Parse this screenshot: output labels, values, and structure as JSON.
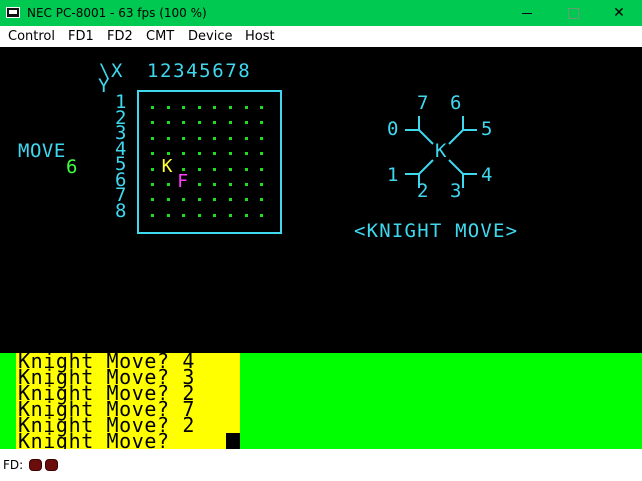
{
  "window": {
    "title": "NEC PC-8001 - 63 fps (100 %)",
    "minimize": "minimize",
    "maximize": "maximize",
    "close": "close"
  },
  "menu": [
    "Control",
    "FD1",
    "FD2",
    "CMT",
    "Device",
    "Host"
  ],
  "game": {
    "axis_corner": "\\X",
    "axis_y": "Y",
    "x_labels": "12345678",
    "y_labels": [
      "1",
      "2",
      "3",
      "4",
      "5",
      "6",
      "7",
      "8"
    ],
    "move_label": "MOVE",
    "move_value": "6",
    "knight_glyph": "K",
    "finish_glyph": "F",
    "knight_pos": {
      "x": 2,
      "y": 5
    },
    "finish_pos": {
      "x": 3,
      "y": 6
    },
    "direction_labels": [
      "0",
      "1",
      "2",
      "3",
      "4",
      "5",
      "6",
      "7"
    ],
    "diagram_center": "K",
    "diagram_caption": "<KNIGHT MOVE>",
    "colors": {
      "cyan": "#3fd8ee",
      "dot_green": "#19e019",
      "knight": "#ffff3c",
      "finish": "#ff3cff",
      "move_value": "#3cff3c"
    }
  },
  "console": {
    "lines": [
      "Knight Move? 4",
      "Knight Move? 3",
      "Knight Move? 2",
      "Knight Move? 7",
      "Knight Move? 2",
      "Knight Move?"
    ],
    "colors": {
      "background": "#00ff00",
      "highlight": "#ffff00"
    }
  },
  "status": {
    "fd_label": "FD:",
    "drive_led_color": "#6b0d0d"
  }
}
